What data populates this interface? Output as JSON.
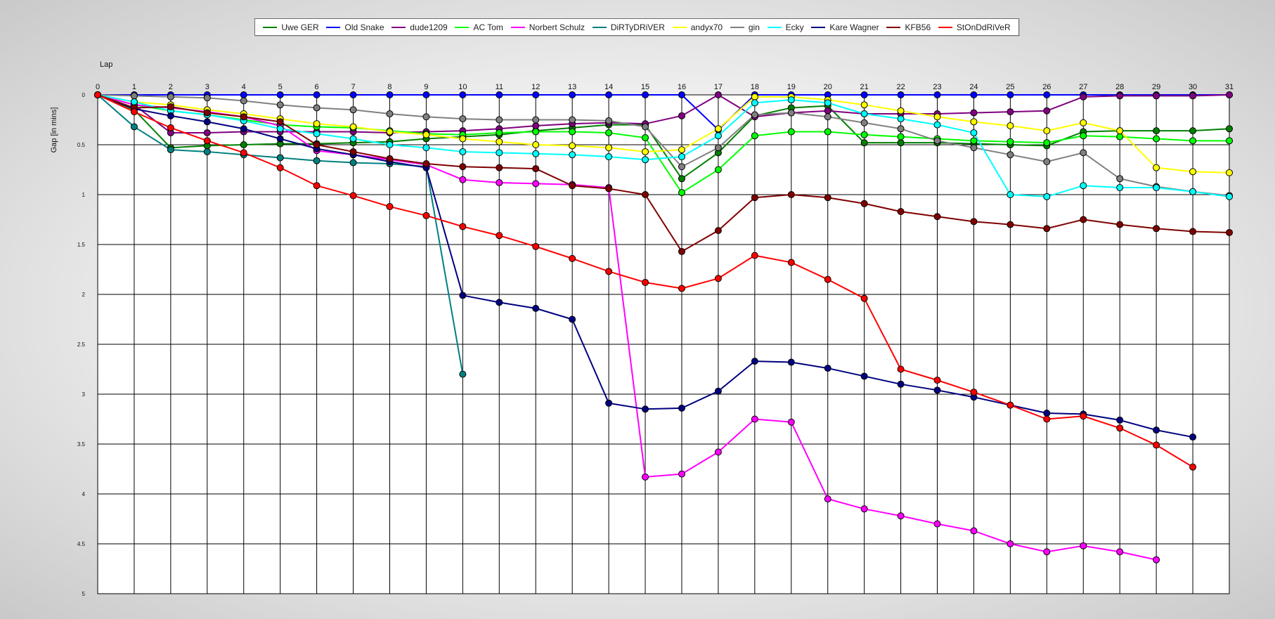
{
  "chart_data": {
    "type": "line",
    "title": "",
    "xlabel": "Lap",
    "ylabel": "Gap [in mins]",
    "x": [
      0,
      1,
      2,
      3,
      4,
      5,
      6,
      7,
      8,
      9,
      10,
      11,
      12,
      13,
      14,
      15,
      16,
      17,
      18,
      19,
      20,
      21,
      22,
      23,
      24,
      25,
      26,
      27,
      28,
      29,
      30,
      31
    ],
    "xlim": [
      0,
      31
    ],
    "ylim": [
      0,
      5
    ],
    "y_inverted": true,
    "x_axis_position": "top",
    "yticks": [
      "0",
      "0.5",
      "1",
      "1.5",
      "2",
      "2.5",
      "3",
      "3.5",
      "4",
      "4.5",
      "5"
    ],
    "grid": true,
    "legend_position": "top-center",
    "series": [
      {
        "name": "Uwe GER",
        "color": "#008000",
        "values": [
          0,
          0.15,
          0.53,
          0.51,
          0.5,
          0.49,
          0.49,
          0.48,
          0.47,
          0.44,
          0.42,
          0.4,
          0.36,
          0.33,
          0.3,
          0.3,
          0.84,
          0.58,
          0.21,
          0.13,
          0.11,
          0.48,
          0.48,
          0.48,
          0.49,
          0.5,
          0.51,
          0.37,
          0.36,
          0.36,
          0.36,
          0.34
        ]
      },
      {
        "name": "Old Snake",
        "color": "#0000ff",
        "values": [
          0,
          0,
          0,
          0,
          0,
          0,
          0,
          0,
          0,
          0,
          0,
          0,
          0,
          0,
          0,
          0,
          0,
          0.35,
          0,
          0,
          0,
          0,
          0,
          0,
          0,
          0,
          0,
          0,
          0,
          0,
          0,
          0
        ]
      },
      {
        "name": "dude1209",
        "color": "#800080",
        "values": [
          0,
          0.1,
          0.38,
          0.38,
          0.37,
          0.37,
          0.37,
          0.37,
          0.38,
          0.37,
          0.36,
          0.34,
          0.31,
          0.29,
          0.28,
          0.29,
          0.21,
          0,
          0.22,
          0.18,
          0.16,
          0.19,
          0.19,
          0.19,
          0.18,
          0.17,
          0.16,
          0.02,
          0.01,
          0.01,
          0.01,
          0
        ]
      },
      {
        "name": "AC Tom",
        "color": "#00ff00",
        "values": [
          0,
          0.1,
          0.16,
          0.2,
          0.25,
          0.3,
          0.32,
          0.33,
          0.36,
          0.39,
          0.4,
          0.38,
          0.37,
          0.37,
          0.38,
          0.43,
          0.98,
          0.75,
          0.41,
          0.37,
          0.37,
          0.4,
          0.42,
          0.44,
          0.46,
          0.47,
          0.48,
          0.41,
          0.42,
          0.44,
          0.46,
          0.46
        ]
      },
      {
        "name": "Norbert Schulz",
        "color": "#ff00ff",
        "values": [
          0,
          0.1,
          0.13,
          0.17,
          0.22,
          0.31,
          0.56,
          0.6,
          0.65,
          0.7,
          0.85,
          0.88,
          0.89,
          0.9,
          0.93,
          3.83,
          3.8,
          3.58,
          3.25,
          3.28,
          4.05,
          4.15,
          4.22,
          4.3,
          4.37,
          4.5,
          4.58,
          4.52,
          4.58,
          4.66,
          null,
          null
        ]
      },
      {
        "name": "DiRTyDRiVER",
        "color": "#008080",
        "values": [
          0,
          0.32,
          0.55,
          0.57,
          0.6,
          0.63,
          0.66,
          0.68,
          0.69,
          0.72,
          2.8,
          null,
          null,
          null,
          null,
          null,
          null,
          null,
          null,
          null,
          null,
          null,
          null,
          null,
          null,
          null,
          null,
          null,
          null,
          null,
          null,
          null
        ]
      },
      {
        "name": "andyx70",
        "color": "#ffff00",
        "values": [
          0,
          0.07,
          0.1,
          0.15,
          0.19,
          0.24,
          0.29,
          0.32,
          0.37,
          0.4,
          0.44,
          0.47,
          0.5,
          0.51,
          0.53,
          0.57,
          0.55,
          0.34,
          0.02,
          0.02,
          0.05,
          0.1,
          0.16,
          0.22,
          0.27,
          0.31,
          0.36,
          0.28,
          0.36,
          0.73,
          0.77,
          0.78
        ]
      },
      {
        "name": "gin",
        "color": "#808080",
        "values": [
          0,
          0.01,
          0.02,
          0.03,
          0.06,
          0.1,
          0.13,
          0.15,
          0.19,
          0.22,
          0.24,
          0.25,
          0.25,
          0.25,
          0.26,
          0.32,
          0.72,
          0.53,
          0.2,
          0.18,
          0.22,
          0.28,
          0.34,
          0.46,
          0.53,
          0.6,
          0.67,
          0.58,
          0.84,
          0.92,
          0.97,
          1.01
        ]
      },
      {
        "name": "Ecky",
        "color": "#00ffff",
        "values": [
          0,
          0.07,
          0.16,
          0.2,
          0.26,
          0.34,
          0.39,
          0.44,
          0.5,
          0.53,
          0.57,
          0.58,
          0.59,
          0.6,
          0.62,
          0.65,
          0.62,
          0.41,
          0.08,
          0.05,
          0.08,
          0.19,
          0.24,
          0.3,
          0.38,
          1.0,
          1.02,
          0.91,
          0.93,
          0.93,
          0.97,
          1.02
        ]
      },
      {
        "name": "Kare Wagner",
        "color": "#000080",
        "values": [
          0,
          0.14,
          0.21,
          0.27,
          0.34,
          0.44,
          0.54,
          0.6,
          0.67,
          0.73,
          2.01,
          2.08,
          2.14,
          2.25,
          3.09,
          3.15,
          3.14,
          2.97,
          2.67,
          2.68,
          2.74,
          2.82,
          2.9,
          2.96,
          3.03,
          3.11,
          3.19,
          3.2,
          3.26,
          3.36,
          3.43,
          null
        ]
      },
      {
        "name": "KFB56",
        "color": "#800000",
        "values": [
          0,
          0.13,
          0.12,
          0.18,
          0.22,
          0.27,
          0.5,
          0.57,
          0.64,
          0.69,
          0.72,
          0.73,
          0.74,
          0.91,
          0.94,
          1.0,
          1.57,
          1.36,
          1.03,
          1.0,
          1.03,
          1.09,
          1.17,
          1.22,
          1.27,
          1.3,
          1.34,
          1.25,
          1.3,
          1.34,
          1.37,
          1.38
        ]
      },
      {
        "name": "StOnDdRiVeR",
        "color": "#ff0000",
        "values": [
          0,
          0.17,
          0.33,
          0.46,
          0.58,
          0.73,
          0.91,
          1.01,
          1.12,
          1.21,
          1.32,
          1.41,
          1.52,
          1.64,
          1.77,
          1.88,
          1.94,
          1.84,
          1.61,
          1.68,
          1.85,
          2.04,
          2.75,
          2.86,
          2.98,
          3.11,
          3.25,
          3.22,
          3.34,
          3.51,
          3.73,
          null
        ]
      }
    ]
  }
}
